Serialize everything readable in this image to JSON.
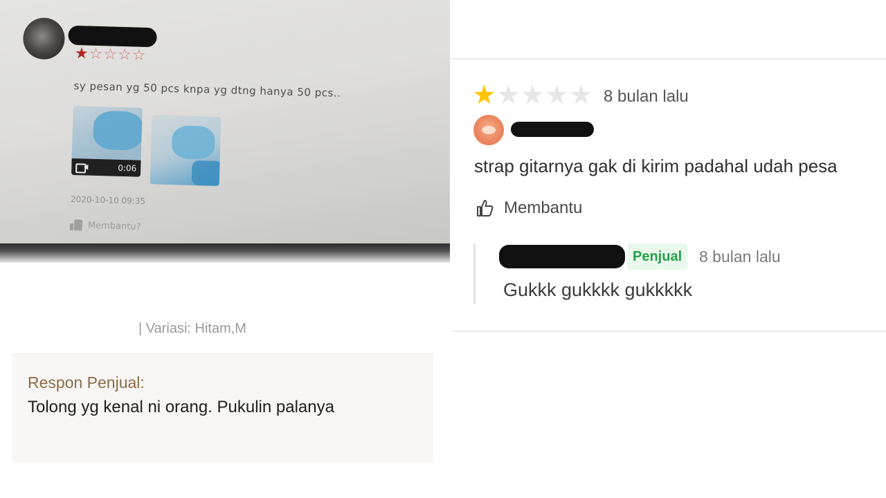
{
  "left_photo": {
    "stars_filled": "★",
    "stars_empty": "☆☆☆☆",
    "rating": 1,
    "rating_max": 5,
    "review_text": "sy pesan yg 50 pcs knpa yg dtng hanya 50 pcs..",
    "video_duration": "0:06",
    "date": "2020-10-10 09:35",
    "helpful_label": "Membantu?"
  },
  "left_bottom": {
    "variation": "| Variasi: Hitam,M",
    "seller_response_label": "Respon Penjual:",
    "seller_response_text": "Tolong yg kenal ni orang. Pukulin palanya"
  },
  "right_review": {
    "rating": 1,
    "rating_max": 5,
    "time_ago": "8 bulan lalu",
    "comment": "strap gitarnya gak di kirim padahal udah pesa",
    "helpful_label": "Membantu",
    "reply": {
      "badge": "Penjual",
      "time_ago": "8 bulan lalu",
      "text": "Gukkk gukkkk gukkkkk"
    },
    "colors": {
      "star_on": "#ffc400",
      "star_off": "#e6e6e6",
      "badge_text": "#22a04a",
      "badge_bg": "#e9f8ea"
    }
  }
}
